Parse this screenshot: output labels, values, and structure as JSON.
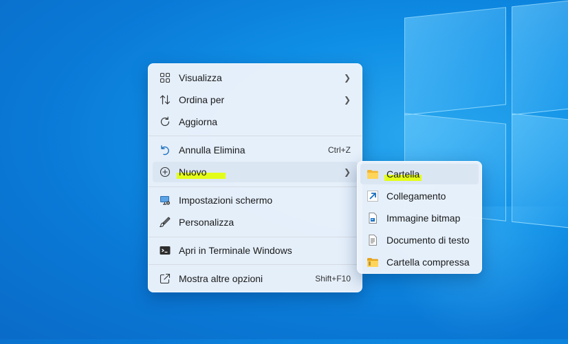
{
  "context_menu": {
    "items": [
      {
        "label": "Visualizza",
        "icon": "grid-view-icon",
        "has_submenu": true
      },
      {
        "label": "Ordina per",
        "icon": "sort-arrows-icon",
        "has_submenu": true
      },
      {
        "label": "Aggiorna",
        "icon": "refresh-icon"
      },
      {
        "label": "Annulla Elimina",
        "icon": "undo-icon",
        "shortcut": "Ctrl+Z"
      },
      {
        "label": "Nuovo",
        "icon": "new-plus-icon",
        "has_submenu": true,
        "highlighted": true
      },
      {
        "label": "Impostazioni schermo",
        "icon": "display-settings-icon"
      },
      {
        "label": "Personalizza",
        "icon": "brush-icon"
      },
      {
        "label": "Apri in Terminale Windows",
        "icon": "terminal-icon"
      },
      {
        "label": "Mostra altre opzioni",
        "icon": "more-options-icon",
        "shortcut": "Shift+F10"
      }
    ]
  },
  "submenu_nuovo": {
    "items": [
      {
        "label": "Cartella",
        "icon": "folder-icon",
        "highlighted": true
      },
      {
        "label": "Collegamento",
        "icon": "shortcut-arrow-icon"
      },
      {
        "label": "Immagine bitmap",
        "icon": "bitmap-image-icon"
      },
      {
        "label": "Documento di testo",
        "icon": "text-document-icon"
      },
      {
        "label": "Cartella compressa",
        "icon": "zip-folder-icon"
      }
    ]
  },
  "colors": {
    "highlight_marker": "#e4ff00",
    "desktop_blue": "#0f8fe6",
    "menu_background": "#ecf3fb"
  }
}
